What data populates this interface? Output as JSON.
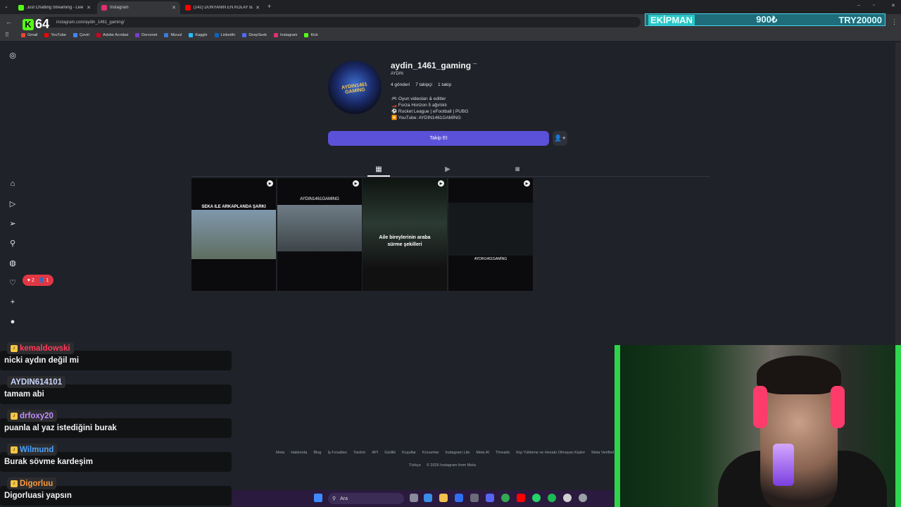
{
  "browser": {
    "tabs": [
      {
        "title": "Just Chatting Streaming - Live",
        "color": "#53fc18"
      },
      {
        "title": "Instagram",
        "color": "#e1306c"
      },
      {
        "title": "(142) DÜNYANIN EN KOLAY BA",
        "color": "#ff0000"
      }
    ],
    "url": "instagram.com/aydin_1461_gaming/",
    "bookmarks": [
      {
        "label": "Gmail",
        "color": "#ea4335"
      },
      {
        "label": "YouTube",
        "color": "#ff0000"
      },
      {
        "label": "Çeviri",
        "color": "#4285f4"
      },
      {
        "label": "Adobe Acrobat",
        "color": "#d6001c"
      },
      {
        "label": "Dersonet",
        "color": "#7a3ccf"
      },
      {
        "label": "Mizuul",
        "color": "#3c7bd6"
      },
      {
        "label": "Kaggle",
        "color": "#20beff"
      },
      {
        "label": "LinkedIn",
        "color": "#0a66c2"
      },
      {
        "label": "DeepSeek",
        "color": "#4d6bfe"
      },
      {
        "label": "Instagram",
        "color": "#e1306c"
      },
      {
        "label": "Kick",
        "color": "#53fc18"
      }
    ]
  },
  "overlay": {
    "kick_label": "K",
    "viewer_count": "64",
    "banner": {
      "name": "EKİPMAN",
      "price": "900₺",
      "goal": "TRY20000"
    }
  },
  "sidebar": {
    "icons": [
      "instagram-icon",
      "home-icon",
      "reels-icon",
      "messages-icon",
      "search-icon",
      "explore-icon",
      "heart-icon",
      "create-icon",
      "profile-icon"
    ],
    "notification": {
      "likes": "2",
      "follows": "1"
    }
  },
  "profile": {
    "username": "aydin_1461_gaming",
    "more": "–",
    "full_name": "AYDIN",
    "avatar_text": "AYDIN1461 GAMING",
    "stats": {
      "posts": "4 gönderi",
      "followers": "7 takipçi",
      "following": "1 takip"
    },
    "bio": [
      "🎮 Oyun videoları & editler",
      "🏎️ Forza Horizon 5 ağırlıklı",
      "⚽ Rocket League | eFootball | PUBG",
      "▶️ YouTube: AYDIN1461GAMİNG"
    ],
    "follow_label": "Takip Et",
    "add_user_icon": "person-plus-icon"
  },
  "posts": [
    {
      "caption": "SEKA ILE ARKAPLANDA ŞARKI",
      "bg": "#5c7285"
    },
    {
      "caption": "AYDIN1461GAMING",
      "bg": "#4b5560"
    },
    {
      "caption": "Aile bireylerinin araba sürme şekilleri",
      "bg": "#2b3a33"
    },
    {
      "caption": "AYDIN1461GAMİNG",
      "bg": "#1a1d20"
    }
  ],
  "footer": {
    "links": [
      "Meta",
      "Hakkında",
      "Blog",
      "İş Fırsatları",
      "Yardım",
      "API",
      "Gizlilik",
      "Koşullar",
      "Konumlar",
      "Instagram Lite",
      "Meta AI",
      "Threads",
      "Kişi Yükleme ve Hesabı Olmayan Kişiler",
      "Meta Verified"
    ],
    "language": "Türkçe",
    "copyright": "© 2026 Instagram from Meta"
  },
  "chat": [
    {
      "user": "kemaldowski",
      "color": "#ff3b5c",
      "text": "nicki aydın değil mi"
    },
    {
      "user": "AYDIN614101",
      "color": "#c9d6ff",
      "text": "tamam abi"
    },
    {
      "user": "drfoxy20",
      "color": "#c08cff",
      "text": "puanla al yaz istediğini burak"
    },
    {
      "user": "Wilmund",
      "color": "#4aa3ff",
      "text": "Burak sövme kardeşim"
    },
    {
      "user": "Digorluu",
      "color": "#ff9a3c",
      "text": "Digorluasi yapsın"
    }
  ],
  "taskbar": {
    "search_placeholder": "Ara"
  }
}
